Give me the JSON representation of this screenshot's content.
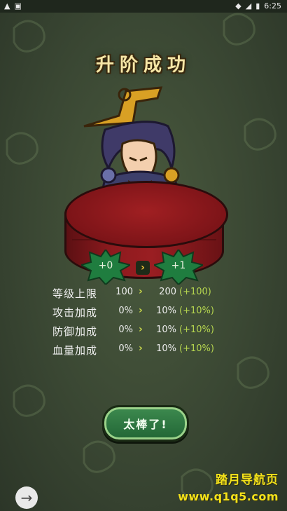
{
  "statusbar": {
    "time": "6:25",
    "left_icons": [
      "warning-icon",
      "image-icon"
    ],
    "right_icons": [
      "wifi-icon",
      "signal-icon",
      "battery-icon"
    ]
  },
  "screen": {
    "title": "升阶成功",
    "rank_from": "+0",
    "rank_to": "+1",
    "stats": [
      {
        "label": "等级上限",
        "from": "100",
        "to": "200",
        "delta": "(+100)"
      },
      {
        "label": "攻击加成",
        "from": "0%",
        "to": "10%",
        "delta": "(+10%)"
      },
      {
        "label": "防御加成",
        "from": "0%",
        "to": "10%",
        "delta": "(+10%)"
      },
      {
        "label": "血量加成",
        "from": "0%",
        "to": "10%",
        "delta": "(+10%)"
      }
    ],
    "confirm_button": "太棒了!"
  },
  "watermark": {
    "line1": "踏月导航页",
    "line2": "www.q1q5.com"
  },
  "colors": {
    "title": "#f6e6a6",
    "delta": "#b6d64f",
    "button": "#2f7b45",
    "stage": "#8e1a1e",
    "badge": "#1f6a3a"
  }
}
